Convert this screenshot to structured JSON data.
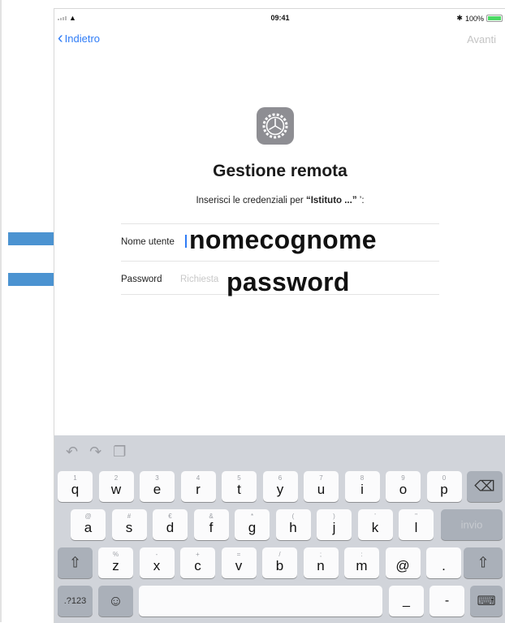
{
  "status": {
    "time": "09:41",
    "battery": "100%"
  },
  "nav": {
    "back_label": "Indietro",
    "next_label": "Avanti"
  },
  "main": {
    "title": "Gestione remota",
    "subtitle_prefix": "Inserisci le credenziali per ",
    "subtitle_org": "“Istituto ...”",
    "subtitle_suffix": " ’:",
    "username_label": "Nome utente",
    "username_overlay": "nomecognome",
    "password_label": "Password",
    "password_placeholder": "Richiesta",
    "password_overlay": "password"
  },
  "keyboard": {
    "row1": [
      {
        "hint": "1",
        "key": "q"
      },
      {
        "hint": "2",
        "key": "w"
      },
      {
        "hint": "3",
        "key": "e"
      },
      {
        "hint": "4",
        "key": "r"
      },
      {
        "hint": "5",
        "key": "t"
      },
      {
        "hint": "6",
        "key": "y"
      },
      {
        "hint": "7",
        "key": "u"
      },
      {
        "hint": "8",
        "key": "i"
      },
      {
        "hint": "9",
        "key": "o"
      },
      {
        "hint": "0",
        "key": "p"
      }
    ],
    "row2": [
      {
        "hint": "@",
        "key": "a"
      },
      {
        "hint": "#",
        "key": "s"
      },
      {
        "hint": "€",
        "key": "d"
      },
      {
        "hint": "&",
        "key": "f"
      },
      {
        "hint": "*",
        "key": "g"
      },
      {
        "hint": "(",
        "key": "h"
      },
      {
        "hint": ")",
        "key": "j"
      },
      {
        "hint": "’",
        "key": "k"
      },
      {
        "hint": "\"",
        "key": "l"
      }
    ],
    "row3": [
      {
        "hint": "%",
        "key": "z"
      },
      {
        "hint": "-",
        "key": "x"
      },
      {
        "hint": "+",
        "key": "c"
      },
      {
        "hint": "=",
        "key": "v"
      },
      {
        "hint": "/",
        "key": "b"
      },
      {
        "hint": ";",
        "key": "n"
      },
      {
        "hint": ":",
        "key": "m"
      },
      {
        "hint": "",
        "key": "@"
      },
      {
        "hint": "",
        "key": "."
      }
    ],
    "return_label": "invio",
    "numbers_label": ".?123",
    "underscore_label": "_",
    "dash_label": "-"
  }
}
